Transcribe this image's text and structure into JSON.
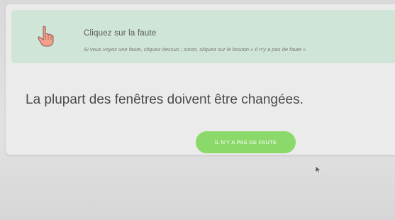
{
  "instruction": {
    "title": "Cliquez sur la faute",
    "text": "Si vous voyez une faute, cliquez dessus ; sinon, cliquez sur le bouton « Il n'y a pas de faute »"
  },
  "exercise": {
    "sentence": "La plupart des fenêtres doivent être changées."
  },
  "buttons": {
    "no_error_label": "IL N'Y A PAS DE FAUTE"
  },
  "icons": {
    "instruction": "hand-pointer-icon",
    "cursor": "mouse-cursor-icon"
  },
  "colors": {
    "banner": "#cfe5d8",
    "button": "#8bd96a",
    "icon_accent": "#f4a08c"
  }
}
